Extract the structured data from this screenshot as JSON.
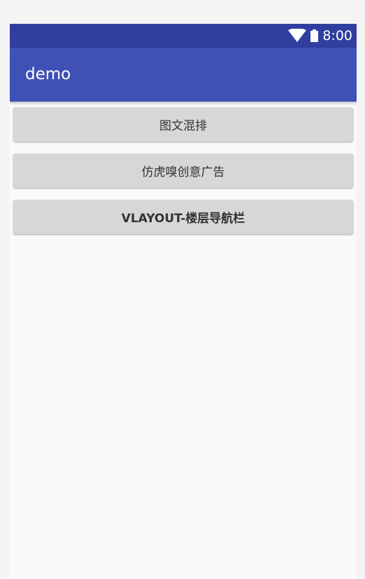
{
  "status_bar": {
    "time": "8:00",
    "icons": [
      "wifi-icon",
      "battery-icon"
    ]
  },
  "app_bar": {
    "title": "demo"
  },
  "buttons": [
    {
      "label": "图文混排"
    },
    {
      "label": "仿虎嗅创意广告"
    },
    {
      "label": "VLAYOUT-楼层导航栏"
    }
  ],
  "colors": {
    "status_bar": "#303f9f",
    "app_bar": "#3f51b5",
    "button_bg": "#d6d7d7",
    "background": "#fafafa"
  }
}
